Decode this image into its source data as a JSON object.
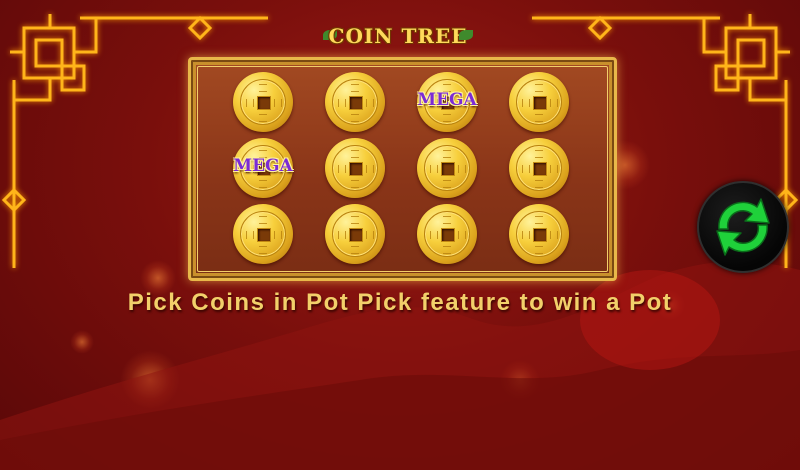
{
  "game": {
    "logo_text": "COIN TREE",
    "instruction": "Pick Coins in Pot Pick feature to win a Pot",
    "refresh_icon": "refresh-arrows-icon"
  },
  "board": {
    "rows": [
      [
        {
          "badge": ""
        },
        {
          "badge": ""
        },
        {
          "badge": "MEGA"
        },
        {
          "badge": ""
        }
      ],
      [
        {
          "badge": "MEGA"
        },
        {
          "badge": ""
        },
        {
          "badge": ""
        },
        {
          "badge": ""
        }
      ],
      [
        {
          "badge": ""
        },
        {
          "badge": ""
        },
        {
          "badge": ""
        },
        {
          "badge": ""
        }
      ]
    ]
  },
  "colors": {
    "background": "#7a0f0c",
    "gold": "#f2d06a",
    "mega": "#7b2bd6",
    "refresh_green": "#1fd13a"
  }
}
